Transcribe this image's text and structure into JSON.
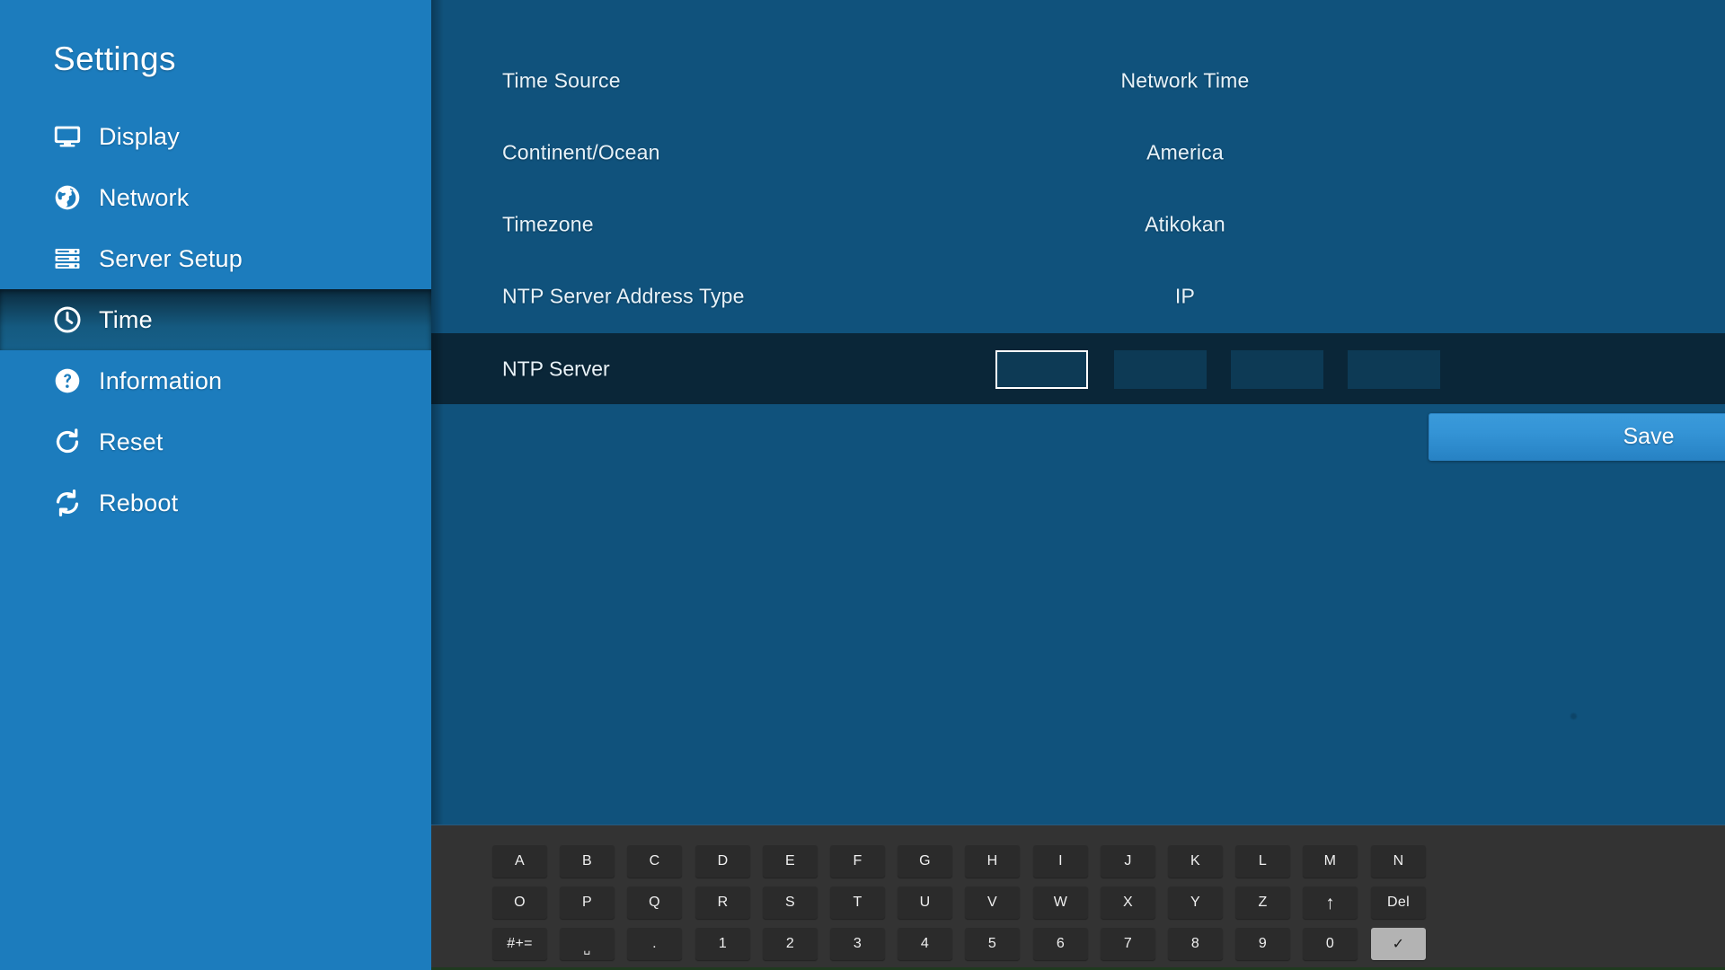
{
  "theme": {
    "sidebar_bg": "#1c7cbd",
    "main_bg": "#10527c",
    "row_highlight_bg": "#0a2638",
    "accent_button": "#3494d6",
    "keyboard_bg": "#333333",
    "key_bg": "#2b2b2b",
    "key_selected_bg": "#b3b3b3",
    "text": "#e8f2f8"
  },
  "sidebar": {
    "title": "Settings",
    "items": [
      {
        "label": "Display",
        "icon": "monitor-icon",
        "selected": false
      },
      {
        "label": "Network",
        "icon": "globe-icon",
        "selected": false
      },
      {
        "label": "Server Setup",
        "icon": "server-rack-icon",
        "selected": false
      },
      {
        "label": "Time",
        "icon": "clock-icon",
        "selected": true
      },
      {
        "label": "Information",
        "icon": "question-circle-icon",
        "selected": false
      },
      {
        "label": "Reset",
        "icon": "refresh-arrow-icon",
        "selected": false
      },
      {
        "label": "Reboot",
        "icon": "sync-arrows-icon",
        "selected": false
      }
    ]
  },
  "main": {
    "rows": [
      {
        "label": "Time Source",
        "value": "Network Time"
      },
      {
        "label": "Continent/Ocean",
        "value": "America"
      },
      {
        "label": "Timezone",
        "value": "Atikokan"
      },
      {
        "label": "NTP Server Address Type",
        "value": "IP"
      }
    ],
    "ntp_server": {
      "label": "NTP Server",
      "octets": [
        {
          "value": "",
          "focused": true
        },
        {
          "value": "",
          "focused": false
        },
        {
          "value": "",
          "focused": false
        },
        {
          "value": "",
          "focused": false
        }
      ]
    },
    "save_label": "Save"
  },
  "keyboard": {
    "rows": [
      {
        "keys": [
          {
            "label": "A"
          },
          {
            "label": "B"
          },
          {
            "label": "C"
          },
          {
            "label": "D"
          },
          {
            "label": "E"
          },
          {
            "label": "F"
          },
          {
            "label": "G"
          },
          {
            "label": "H"
          },
          {
            "label": "I"
          },
          {
            "label": "J"
          },
          {
            "label": "K"
          },
          {
            "label": "L"
          },
          {
            "label": "M"
          },
          {
            "label": "N"
          }
        ]
      },
      {
        "keys": [
          {
            "label": "O"
          },
          {
            "label": "P"
          },
          {
            "label": "Q"
          },
          {
            "label": "R"
          },
          {
            "label": "S"
          },
          {
            "label": "T"
          },
          {
            "label": "U"
          },
          {
            "label": "V"
          },
          {
            "label": "W"
          },
          {
            "label": "X"
          },
          {
            "label": "Y"
          },
          {
            "label": "Z"
          },
          {
            "label": "↑",
            "name": "shift-key",
            "style": "arrow"
          },
          {
            "label": "Del",
            "name": "delete-key"
          }
        ]
      },
      {
        "keys": [
          {
            "label": "#+=",
            "name": "symbols-key"
          },
          {
            "label": "␣",
            "name": "space-key",
            "style": "space"
          },
          {
            "label": ".",
            "name": "period-key"
          },
          {
            "label": "1"
          },
          {
            "label": "2"
          },
          {
            "label": "3"
          },
          {
            "label": "4"
          },
          {
            "label": "5"
          },
          {
            "label": "6"
          },
          {
            "label": "7"
          },
          {
            "label": "8"
          },
          {
            "label": "9"
          },
          {
            "label": "0"
          },
          {
            "label": "✓",
            "name": "confirm-key",
            "selected": true
          }
        ]
      }
    ]
  }
}
